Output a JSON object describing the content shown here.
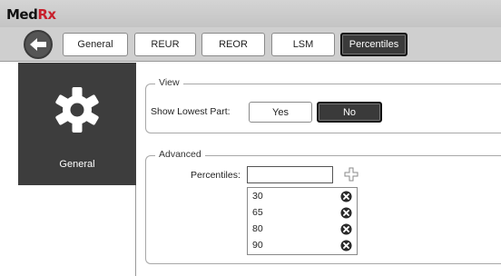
{
  "logo": {
    "med": "Med",
    "rx": "Rx"
  },
  "tabs": [
    {
      "label": "General",
      "active": false
    },
    {
      "label": "REUR",
      "active": false
    },
    {
      "label": "REOR",
      "active": false
    },
    {
      "label": "LSM",
      "active": false
    },
    {
      "label": "Percentiles",
      "active": true
    }
  ],
  "sidebar": {
    "items": [
      {
        "label": "General",
        "icon": "gear-icon",
        "selected": true
      }
    ]
  },
  "view": {
    "title": "View",
    "show_lowest_part_label": "Show Lowest Part:",
    "yes_label": "Yes",
    "no_label": "No",
    "selected": "No"
  },
  "advanced": {
    "title": "Advanced",
    "percentiles_label": "Percentiles:",
    "percentiles_input_value": "",
    "percentile_values": [
      "30",
      "65",
      "80",
      "90"
    ]
  },
  "colors": {
    "selected_dark": "#3a3a3a",
    "rx_red": "#c8202c",
    "chrome_gray": "#cfcfcf"
  }
}
